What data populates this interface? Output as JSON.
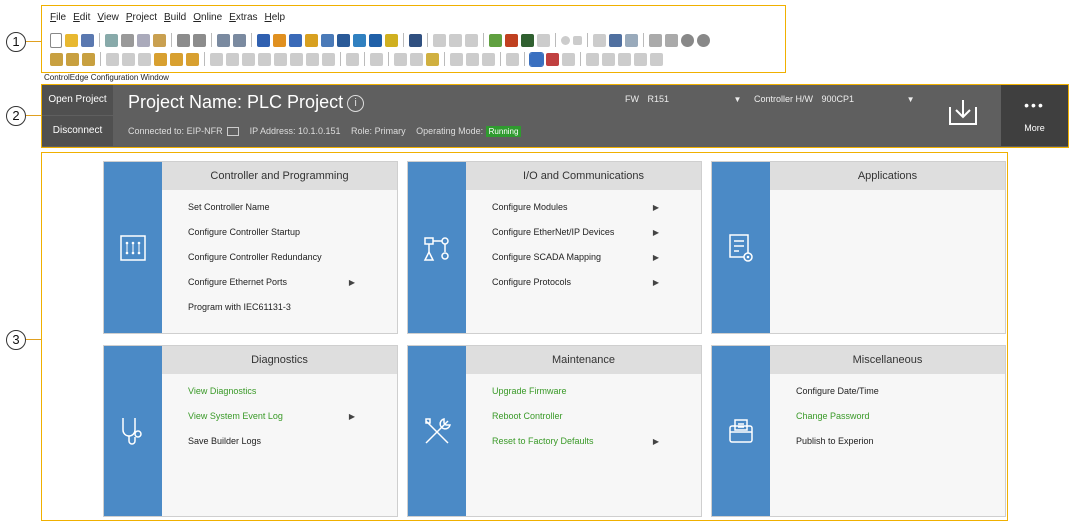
{
  "menu": [
    "File",
    "Edit",
    "View",
    "Project",
    "Build",
    "Online",
    "Extras",
    "Help"
  ],
  "window_label": "ControlEdge Configuration Window",
  "callouts": [
    "1",
    "2",
    "3"
  ],
  "header": {
    "open_project": "Open Project",
    "disconnect": "Disconnect",
    "project_title": "Project Name: PLC Project",
    "info_glyph": "i",
    "connected_label": "Connected to:",
    "connected_value": "EIP-NFR",
    "ip_label": "IP Address:",
    "ip_value": "10.1.0.151",
    "role_label": "Role:",
    "role_value": "Primary",
    "mode_label": "Operating Mode:",
    "mode_value": "Running",
    "fw_label": "FW",
    "fw_value": "R151",
    "hw_label": "Controller H/W",
    "hw_value": "900CP1",
    "more_dots": "•••",
    "more_label": "More"
  },
  "cards": [
    {
      "title": "Controller and Programming",
      "icon": "controller-icon",
      "items": [
        {
          "label": "Set Controller Name",
          "submenu": false,
          "link": false
        },
        {
          "label": "Configure Controller Startup",
          "submenu": false,
          "link": false
        },
        {
          "label": "Configure Controller Redundancy",
          "submenu": false,
          "link": false
        },
        {
          "label": "Configure Ethernet Ports",
          "submenu": true,
          "link": false
        },
        {
          "label": "Program with IEC61131-3",
          "submenu": false,
          "link": false
        }
      ]
    },
    {
      "title": "I/O and Communications",
      "icon": "network-icon",
      "items": [
        {
          "label": "Configure Modules",
          "submenu": true,
          "link": false
        },
        {
          "label": "Configure EtherNet/IP Devices",
          "submenu": true,
          "link": false
        },
        {
          "label": "Configure SCADA Mapping",
          "submenu": true,
          "link": false
        },
        {
          "label": "Configure Protocols",
          "submenu": true,
          "link": false
        }
      ]
    },
    {
      "title": "Applications",
      "icon": "application-settings-icon",
      "items": []
    },
    {
      "title": "Diagnostics",
      "icon": "stethoscope-icon",
      "items": [
        {
          "label": "View Diagnostics",
          "submenu": false,
          "link": true
        },
        {
          "label": "View System Event Log",
          "submenu": true,
          "link": true
        },
        {
          "label": "Save Builder Logs",
          "submenu": false,
          "link": false
        }
      ]
    },
    {
      "title": "Maintenance",
      "icon": "tools-icon",
      "items": [
        {
          "label": "Upgrade Firmware",
          "submenu": false,
          "link": true
        },
        {
          "label": "Reboot Controller",
          "submenu": false,
          "link": true
        },
        {
          "label": "Reset to Factory Defaults",
          "submenu": true,
          "link": true
        }
      ]
    },
    {
      "title": "Miscellaneous",
      "icon": "toolbox-icon",
      "items": [
        {
          "label": "Configure Date/Time",
          "submenu": false,
          "link": false
        },
        {
          "label": "Change Password",
          "submenu": false,
          "link": true
        },
        {
          "label": "Publish to Experion",
          "submenu": false,
          "link": false
        }
      ]
    }
  ],
  "colors": {
    "accent": "#4b8ac6",
    "link_green": "#3a9a28",
    "header_bg": "#5f5f5f",
    "callout_border": "#f0b000"
  }
}
